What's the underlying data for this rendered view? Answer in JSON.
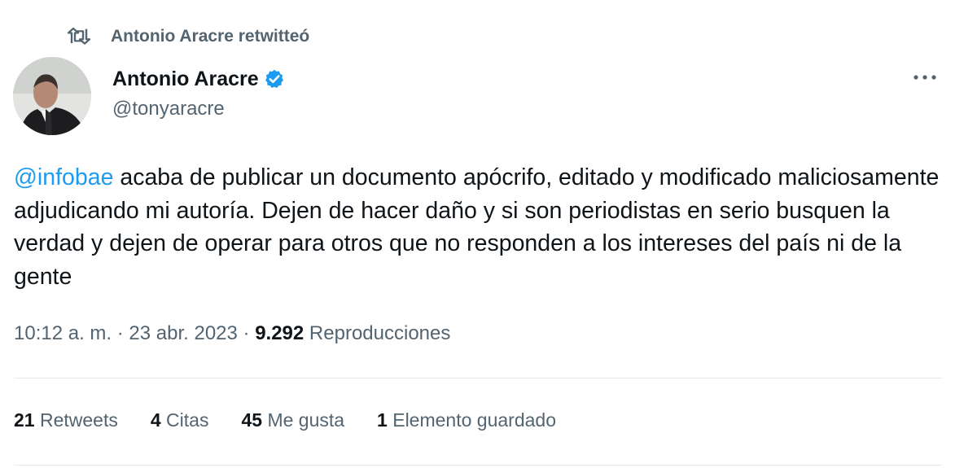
{
  "colors": {
    "accent": "#1d9bf0",
    "secondary_text": "#536471",
    "primary_text": "#0f1419"
  },
  "retweet_header": {
    "icon": "retweet-icon",
    "text": "Antonio Aracre retwitteó"
  },
  "author": {
    "avatar": "avatar-photo",
    "name": "Antonio Aracre",
    "verified_icon": "verified-badge-icon",
    "handle": "@tonyaracre"
  },
  "more_button": {
    "icon": "more-horizontal-icon"
  },
  "tweet": {
    "mention": "@infobae",
    "body": " acaba de publicar un documento apócrifo, editado y modificado maliciosamente adjudicando mi autoría. Dejen de hacer daño y si son periodistas en serio busquen la verdad y dejen de operar para otros que no responden a los intereses del país ni de la gente"
  },
  "meta": {
    "time": "10:12 a. m.",
    "separator": " · ",
    "date": "23 abr. 2023",
    "views_count": "9.292",
    "views_label": "Reproducciones"
  },
  "stats": [
    {
      "name": "retweets",
      "count": "21",
      "label": "Retweets"
    },
    {
      "name": "quotes",
      "count": "4",
      "label": "Citas"
    },
    {
      "name": "likes",
      "count": "45",
      "label": "Me gusta"
    },
    {
      "name": "bookmarks",
      "count": "1",
      "label": "Elemento guardado"
    }
  ]
}
